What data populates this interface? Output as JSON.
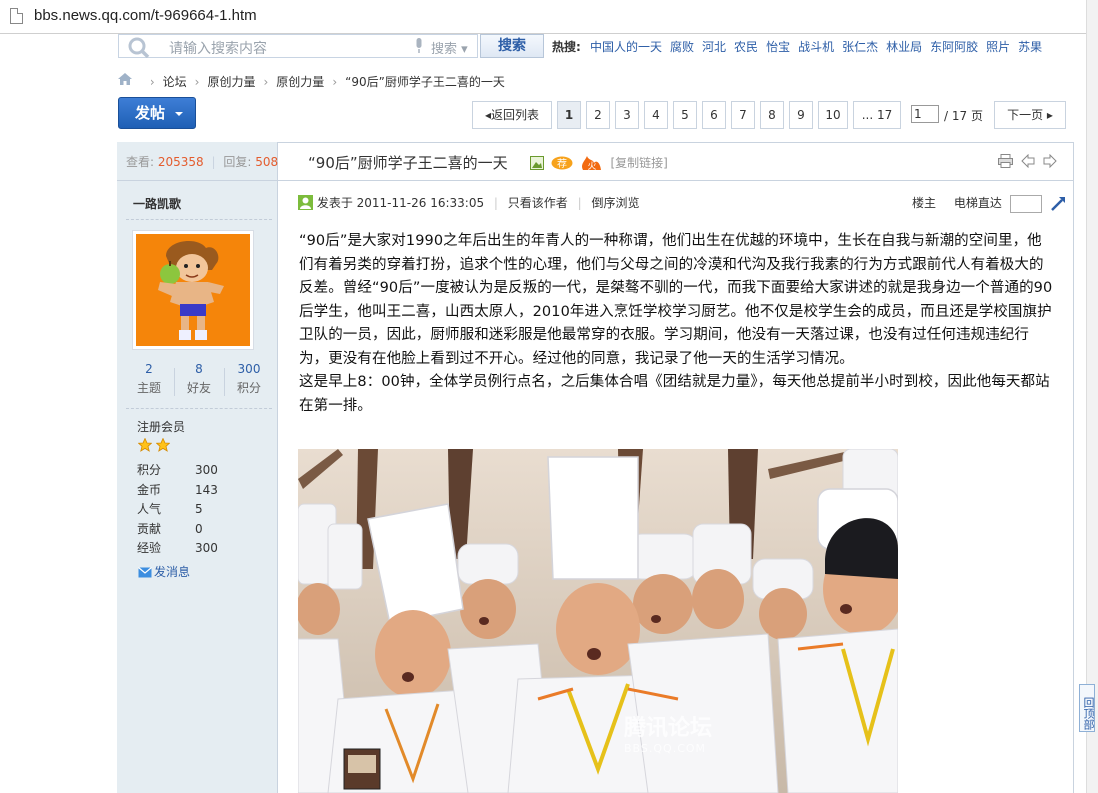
{
  "browser": {
    "url": "bbs.news.qq.com/t-969664-1.htm"
  },
  "search": {
    "placeholder": "请输入搜索内容",
    "type_label": "搜索",
    "button": "搜索",
    "hot_label": "热搜:",
    "hot_items": [
      "中国人的一天",
      "腐败",
      "河北",
      "农民",
      "怡宝",
      "战斗机",
      "张仁杰",
      "林业局",
      "东阿阿胶",
      "照片",
      "苏果"
    ]
  },
  "breadcrumb": [
    "论坛",
    "原创力量",
    "原创力量",
    "“90后”厨师学子王二喜的一天"
  ],
  "post_button": "发帖",
  "pager": {
    "back": "返回列表",
    "pages": [
      "1",
      "2",
      "3",
      "4",
      "5",
      "6",
      "7",
      "8",
      "9",
      "10",
      "... 17"
    ],
    "current": "1",
    "input_value": "1",
    "total_label": "/ 17 页",
    "next": "下一页"
  },
  "thread": {
    "views_label": "查看:",
    "views": "205358",
    "replies_label": "回复:",
    "replies": "508",
    "title": "“90后”厨师学子王二喜的一天",
    "copy_link": "[复制链接]"
  },
  "author": {
    "name": "一路凯歌",
    "counts": [
      {
        "num": "2",
        "label": "主题"
      },
      {
        "num": "8",
        "label": "好友"
      },
      {
        "num": "300",
        "label": "积分"
      }
    ],
    "group": "注册会员",
    "attrs": [
      {
        "k": "积分",
        "v": "300"
      },
      {
        "k": "金币",
        "v": "143"
      },
      {
        "k": "人气",
        "v": "5"
      },
      {
        "k": "贡献",
        "v": "0"
      },
      {
        "k": "经验",
        "v": "300"
      }
    ],
    "message": "发消息"
  },
  "post": {
    "posted_at": "发表于 2011-11-26 16:33:05",
    "only_author": "只看该作者",
    "reverse": "倒序浏览",
    "floor_label": "楼主",
    "elevator": "电梯直达",
    "paragraphs": [
      "“90后”是大家对1990之年后出生的年青人的一种称谓，他们出生在优越的环境中，生长在自我与新潮的空间里，他们有着另类的穿着打扮，追求个性的心理，他们与父母之间的冷漠和代沟及我行我素的行为方式跟前代人有着极大的反差。曾经“90后”一度被认为是反叛的一代，是桀骜不驯的一代，而我下面要给大家讲述的就是我身边一个普通的90后学生，他叫王二喜，山西太原人，2010年进入烹饪学校学习厨艺。他不仅是校学生会的成员，而且还是学校国旗护卫队的一员，因此，厨师服和迷彩服是他最常穿的衣服。学习期间，他没有一天落过课，也没有过任何违规违纪行为，更没有在他脸上看到过不开心。经过他的同意，我记录了他一天的生活学习情况。",
      "这是早上8：00钟，全体学员例行点名，之后集体合唱《团结就是力量》，每天他总提前半小时到校，因此他每天都站在第一排。"
    ],
    "watermark": "腾讯论坛",
    "watermark_sub": "BBS.QQ.COM"
  },
  "back_top": "回顶部",
  "colors": {
    "link": "#2d5ea7",
    "accent": "#e45c2e",
    "sidebar": "#e5edf2",
    "post_button": "#1e5fb5"
  }
}
